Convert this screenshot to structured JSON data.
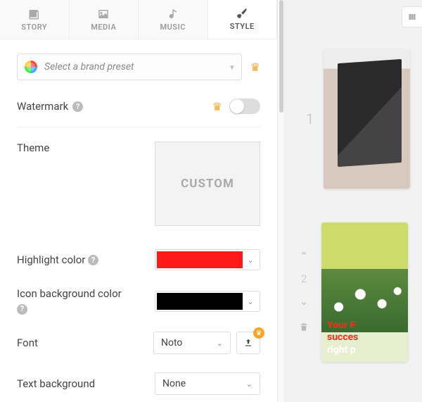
{
  "tabs": {
    "story": "STORY",
    "media": "MEDIA",
    "music": "MUSIC",
    "style": "STYLE"
  },
  "active_tab": "style",
  "brand": {
    "placeholder": "Select a brand preset"
  },
  "watermark": {
    "label": "Watermark",
    "enabled": false
  },
  "theme": {
    "label": "Theme",
    "value": "CUSTOM"
  },
  "highlight": {
    "label": "Highlight color",
    "value": "#ff1a1a"
  },
  "icon_bg": {
    "label": "Icon background color",
    "value": "#000000"
  },
  "font": {
    "label": "Font",
    "value": "Noto"
  },
  "text_bg": {
    "label": "Text background",
    "value": "None"
  },
  "slides": {
    "s1": {
      "index": "1"
    },
    "s2": {
      "index": "2",
      "line1": "Your F",
      "line2": "succes",
      "line3": "right p"
    }
  }
}
